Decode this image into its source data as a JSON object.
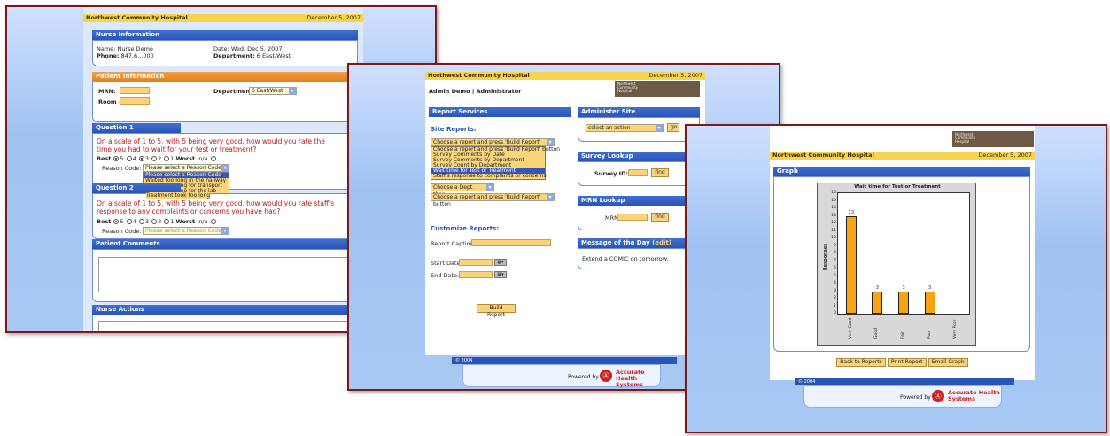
{
  "hospital": {
    "name": "Northwest Community Hospital"
  },
  "window1": {
    "date": "December 5, 2007",
    "nurse_info": {
      "title": "Nurse Information",
      "name_label": "Name:",
      "name_value": "Nurse Demo",
      "phone_label": "Phone:",
      "phone_value": "847.6...000",
      "date_label": "Date:",
      "date_value": "Wed, Dec 5, 2007",
      "dept_label": "Department:",
      "dept_value": "6 East/West"
    },
    "patient_info": {
      "title": "Patient Information",
      "mrn_label": "MRN:",
      "room_label": "Room #:",
      "dept_label": "Department:",
      "dept_value": "6 East/West"
    },
    "q1": {
      "title": "Question 1",
      "text": "On a scale of 1 to 5, with 5 being very good, how would you rate the time you had to wait for your test or treatment?",
      "best": "Best",
      "worst": "Worst",
      "na": "n/a",
      "scale": [
        "5",
        "4",
        "3",
        "2",
        "1"
      ],
      "reason_label": "Reason Code:",
      "reason_value": "Please select a Reason Code",
      "reason_options": [
        "Please select a Reason Code",
        "Waited too long in the hallway",
        "Waited too long for transport",
        "Waited too long for the lab",
        "Treatment took too long"
      ]
    },
    "q2": {
      "title": "Question 2",
      "text": "On a scale of 1 to 5, with 5 being very good, how would you rate staff's response to any complaints or concerns you have had?",
      "best": "Best",
      "worst": "Worst",
      "na": "n/a",
      "scale": [
        "5",
        "4",
        "3",
        "2",
        "1"
      ],
      "reason_label": "Reason Code:",
      "reason_value": "Please select a Reason Code"
    },
    "comments": {
      "title": "Patient Comments"
    },
    "actions": {
      "title": "Nurse Actions"
    }
  },
  "window2": {
    "date": "December 5, 2007",
    "user": "Admin Demo | Administrator",
    "logo_lines": [
      "Northwest",
      "Community",
      "Hospital"
    ],
    "report_services": {
      "title": "Report Services"
    },
    "site_reports_label": "Site Reports:",
    "report_select": "Choose a report and press 'Build Report' button",
    "report_options": [
      "Choose a report and press 'Build Report' button",
      "Choose a report and press 'Build Report' button",
      "Survey Comments by Date",
      "Survey Comments by Department",
      "Survey Count by Department",
      "Wait time for Test or Treatment",
      "Staff's response to complaints or concerns"
    ],
    "dept_select": "Choose a Dept. then...",
    "report_select2": "Choose a report and press 'Build Report' button",
    "customize_label": "Customize Reports:",
    "caption_label": "Report Caption:",
    "start_label": "Start Date:",
    "end_label": "End Date:",
    "build_button": "Build Report",
    "admin_site": {
      "title": "Administer Site",
      "select": "select an action",
      "go": "go"
    },
    "survey_lookup": {
      "title": "Survey Lookup",
      "label": "Survey ID:",
      "find": "find"
    },
    "mrn_lookup": {
      "title": "MRN Lookup",
      "label": "MRN:",
      "find": "find"
    },
    "motd": {
      "title": "Message of the Day",
      "edit": "(edit)",
      "text": "Extend a COMIC on tomorrow."
    },
    "footer": "© 2004",
    "powered_by": "Powered by",
    "company": [
      "Accurate Health",
      "Systems"
    ]
  },
  "window3": {
    "date": "December 5, 2007",
    "logo_lines": [
      "Northwest",
      "Community",
      "Hospital"
    ],
    "graph_title": "Graph",
    "buttons": {
      "back": "Back to Reports",
      "print": "Print Report",
      "email": "Email Graph"
    },
    "footer": "© 2004",
    "powered_by": "Powered by",
    "company": [
      "Accurate Health",
      "Systems"
    ]
  },
  "chart_data": {
    "type": "bar",
    "title": "Wait time for Test or Treatment",
    "ylabel": "Responses",
    "categories": [
      "Very Good",
      "Good",
      "Fair",
      "Poor",
      "Very Poor"
    ],
    "values": [
      13,
      3,
      3,
      3,
      0
    ],
    "data_labels": [
      "13",
      "3",
      "3",
      "3",
      ""
    ],
    "ylim": [
      0,
      16
    ],
    "yticks": [
      "0",
      "1",
      "2",
      "3",
      "4",
      "5",
      "6",
      "7",
      "8",
      "9",
      "10",
      "11",
      "12",
      "13",
      "14",
      "15",
      "16"
    ],
    "grid": false,
    "bar_color": "#f7a414"
  }
}
